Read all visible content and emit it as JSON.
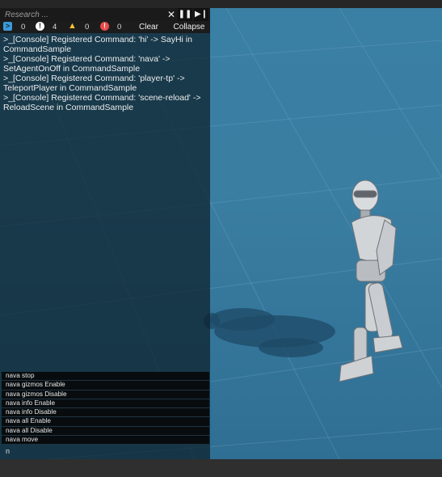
{
  "search": {
    "placeholder": "Research ..."
  },
  "toolbar": {
    "clear_search_icon": "close-icon",
    "pause_icon": "pause-icon",
    "step_icon": "step-forward-icon"
  },
  "filters": {
    "log": {
      "count": "0",
      "icon": "log-icon",
      "color": "#3b9ad9"
    },
    "info": {
      "count": "4",
      "icon": "info-icon",
      "color": "#ffffff"
    },
    "warning": {
      "count": "0",
      "icon": "warning-icon",
      "color": "#f2c230"
    },
    "error": {
      "count": "0",
      "icon": "error-icon",
      "color": "#e84a4a"
    },
    "clear_label": "Clear",
    "collapse_label": "Collapse"
  },
  "log": [
    ">_[Console] Registered Command: 'hi' -> SayHi in CommandSample",
    ">_[Console] Registered Command: 'nava' -> SetAgentOnOff in CommandSample",
    ">_[Console] Registered Command: 'player-tp' -> TeleportPlayer in CommandSample",
    ">_[Console] Registered Command: 'scene-reload' -> ReloadScene in CommandSample"
  ],
  "suggestions": [
    "nava stop",
    "nava gizmos Enable",
    "nava gizmos Disable",
    "nava info Enable",
    "nava info Disable",
    "nava all Enable",
    "nava all Disable",
    "nava move"
  ],
  "command_input": {
    "value": "n"
  },
  "colors": {
    "scene_blue": "#3a7fa4",
    "console_bg": "#0c202a"
  }
}
